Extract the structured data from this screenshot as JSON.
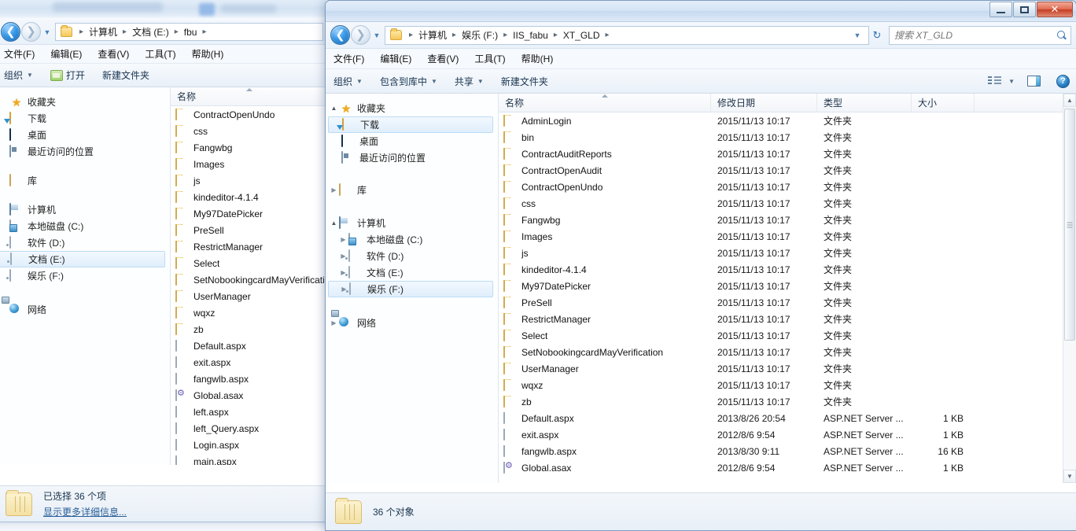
{
  "back_window": {
    "address": {
      "breadcrumbs": [
        "计算机",
        "文档 (E:)",
        "fbu"
      ],
      "separator": "▸"
    },
    "menus": [
      "文件(F)",
      "编辑(E)",
      "查看(V)",
      "工具(T)",
      "帮助(H)"
    ],
    "commands": {
      "organize": "组织",
      "open": "打开",
      "new_folder": "新建文件夹"
    },
    "nav_pane": [
      {
        "label": "收藏夹",
        "icon": "star-icon",
        "level": 0,
        "twisty": "",
        "selected": false
      },
      {
        "label": "下载",
        "icon": "downloads-icon",
        "level": 1,
        "twisty": "",
        "selected": false
      },
      {
        "label": "桌面",
        "icon": "desktop-icon",
        "level": 1,
        "twisty": "",
        "selected": false
      },
      {
        "label": "最近访问的位置",
        "icon": "recent-places-icon",
        "level": 1,
        "twisty": "",
        "selected": false
      },
      {
        "label": "库",
        "icon": "library-icon",
        "level": 0,
        "twisty": "",
        "selected": false
      },
      {
        "label": "计算机",
        "icon": "computer-icon",
        "level": 0,
        "twisty": "",
        "selected": false
      },
      {
        "label": "本地磁盘 (C:)",
        "icon": "system-drive-icon",
        "level": 1,
        "twisty": "",
        "selected": false
      },
      {
        "label": "软件 (D:)",
        "icon": "drive-icon",
        "level": 1,
        "twisty": "",
        "selected": false
      },
      {
        "label": "文档 (E:)",
        "icon": "drive-icon",
        "level": 1,
        "twisty": "",
        "selected": true
      },
      {
        "label": "娱乐 (F:)",
        "icon": "drive-icon",
        "level": 1,
        "twisty": "",
        "selected": false
      },
      {
        "label": "网络",
        "icon": "network-icon",
        "level": 0,
        "twisty": "",
        "selected": false
      }
    ],
    "column_header": "名称",
    "files": [
      {
        "name": "ContractOpenUndo",
        "icon": "folder-icon"
      },
      {
        "name": "css",
        "icon": "folder-icon"
      },
      {
        "name": "Fangwbg",
        "icon": "folder-icon"
      },
      {
        "name": "Images",
        "icon": "folder-icon"
      },
      {
        "name": "js",
        "icon": "folder-icon"
      },
      {
        "name": "kindeditor-4.1.4",
        "icon": "folder-icon"
      },
      {
        "name": "My97DatePicker",
        "icon": "folder-icon"
      },
      {
        "name": "PreSell",
        "icon": "folder-icon"
      },
      {
        "name": "RestrictManager",
        "icon": "folder-icon"
      },
      {
        "name": "Select",
        "icon": "folder-icon"
      },
      {
        "name": "SetNobookingcardMayVerification",
        "icon": "folder-icon"
      },
      {
        "name": "UserManager",
        "icon": "folder-icon"
      },
      {
        "name": "wqxz",
        "icon": "folder-icon"
      },
      {
        "name": "zb",
        "icon": "folder-icon"
      },
      {
        "name": "Default.aspx",
        "icon": "aspx-file-icon"
      },
      {
        "name": "exit.aspx",
        "icon": "aspx-file-icon"
      },
      {
        "name": "fangwlb.aspx",
        "icon": "aspx-file-icon"
      },
      {
        "name": "Global.asax",
        "icon": "asax-file-icon"
      },
      {
        "name": "left.aspx",
        "icon": "aspx-file-icon"
      },
      {
        "name": "left_Query.aspx",
        "icon": "aspx-file-icon"
      },
      {
        "name": "Login.aspx",
        "icon": "aspx-file-icon"
      },
      {
        "name": "main.aspx",
        "icon": "aspx-file-icon"
      }
    ],
    "status": {
      "line1": "已选择 36 个项",
      "link": "显示更多详细信息..."
    }
  },
  "front_window": {
    "title": "",
    "window_buttons": {
      "minimize": "—",
      "maximize": "❐",
      "close": "✕"
    },
    "address": {
      "breadcrumbs": [
        "计算机",
        "娱乐 (F:)",
        "IIS_fabu",
        "XT_GLD"
      ],
      "separator": "▸"
    },
    "search": {
      "placeholder": "搜索 XT_GLD",
      "value": ""
    },
    "menus": [
      "文件(F)",
      "编辑(E)",
      "查看(V)",
      "工具(T)",
      "帮助(H)"
    ],
    "commands": {
      "organize": "组织",
      "include_in_library": "包含到库中",
      "share": "共享",
      "new_folder": "新建文件夹"
    },
    "nav_pane": [
      {
        "label": "收藏夹",
        "icon": "star-icon",
        "level": 0,
        "twisty": "▲",
        "selected": false
      },
      {
        "label": "下载",
        "icon": "downloads-icon",
        "level": 1,
        "twisty": "",
        "selected": true
      },
      {
        "label": "桌面",
        "icon": "desktop-icon",
        "level": 1,
        "twisty": "",
        "selected": false
      },
      {
        "label": "最近访问的位置",
        "icon": "recent-places-icon",
        "level": 1,
        "twisty": "",
        "selected": false
      },
      {
        "label": "库",
        "icon": "library-icon",
        "level": 0,
        "twisty": "▶",
        "selected": false
      },
      {
        "label": "计算机",
        "icon": "computer-icon",
        "level": 0,
        "twisty": "▲",
        "selected": false
      },
      {
        "label": "本地磁盘 (C:)",
        "icon": "system-drive-icon",
        "level": 1,
        "twisty": "▶",
        "selected": false
      },
      {
        "label": "软件 (D:)",
        "icon": "drive-icon",
        "level": 1,
        "twisty": "▶",
        "selected": false
      },
      {
        "label": "文档 (E:)",
        "icon": "drive-icon",
        "level": 1,
        "twisty": "▶",
        "selected": false
      },
      {
        "label": "娱乐 (F:)",
        "icon": "drive-icon",
        "level": 1,
        "twisty": "▶",
        "selected": true
      },
      {
        "label": "网络",
        "icon": "network-icon",
        "level": 0,
        "twisty": "▶",
        "selected": false
      }
    ],
    "columns": [
      "名称",
      "修改日期",
      "类型",
      "大小"
    ],
    "files": [
      {
        "name": "AdminLogin",
        "date": "2015/11/13 10:17",
        "type": "文件夹",
        "size": "",
        "icon": "folder-icon"
      },
      {
        "name": "bin",
        "date": "2015/11/13 10:17",
        "type": "文件夹",
        "size": "",
        "icon": "folder-icon"
      },
      {
        "name": "ContractAuditReports",
        "date": "2015/11/13 10:17",
        "type": "文件夹",
        "size": "",
        "icon": "folder-icon"
      },
      {
        "name": "ContractOpenAudit",
        "date": "2015/11/13 10:17",
        "type": "文件夹",
        "size": "",
        "icon": "folder-icon"
      },
      {
        "name": "ContractOpenUndo",
        "date": "2015/11/13 10:17",
        "type": "文件夹",
        "size": "",
        "icon": "folder-icon"
      },
      {
        "name": "css",
        "date": "2015/11/13 10:17",
        "type": "文件夹",
        "size": "",
        "icon": "folder-icon"
      },
      {
        "name": "Fangwbg",
        "date": "2015/11/13 10:17",
        "type": "文件夹",
        "size": "",
        "icon": "folder-icon"
      },
      {
        "name": "Images",
        "date": "2015/11/13 10:17",
        "type": "文件夹",
        "size": "",
        "icon": "folder-icon"
      },
      {
        "name": "js",
        "date": "2015/11/13 10:17",
        "type": "文件夹",
        "size": "",
        "icon": "folder-icon"
      },
      {
        "name": "kindeditor-4.1.4",
        "date": "2015/11/13 10:17",
        "type": "文件夹",
        "size": "",
        "icon": "folder-icon"
      },
      {
        "name": "My97DatePicker",
        "date": "2015/11/13 10:17",
        "type": "文件夹",
        "size": "",
        "icon": "folder-icon"
      },
      {
        "name": "PreSell",
        "date": "2015/11/13 10:17",
        "type": "文件夹",
        "size": "",
        "icon": "folder-icon"
      },
      {
        "name": "RestrictManager",
        "date": "2015/11/13 10:17",
        "type": "文件夹",
        "size": "",
        "icon": "folder-icon"
      },
      {
        "name": "Select",
        "date": "2015/11/13 10:17",
        "type": "文件夹",
        "size": "",
        "icon": "folder-icon"
      },
      {
        "name": "SetNobookingcardMayVerification",
        "date": "2015/11/13 10:17",
        "type": "文件夹",
        "size": "",
        "icon": "folder-icon"
      },
      {
        "name": "UserManager",
        "date": "2015/11/13 10:17",
        "type": "文件夹",
        "size": "",
        "icon": "folder-icon"
      },
      {
        "name": "wqxz",
        "date": "2015/11/13 10:17",
        "type": "文件夹",
        "size": "",
        "icon": "folder-icon"
      },
      {
        "name": "zb",
        "date": "2015/11/13 10:17",
        "type": "文件夹",
        "size": "",
        "icon": "folder-icon"
      },
      {
        "name": "Default.aspx",
        "date": "2013/8/26 20:54",
        "type": "ASP.NET Server ...",
        "size": "1 KB",
        "icon": "aspx-file-icon"
      },
      {
        "name": "exit.aspx",
        "date": "2012/8/6 9:54",
        "type": "ASP.NET Server ...",
        "size": "1 KB",
        "icon": "aspx-file-icon"
      },
      {
        "name": "fangwlb.aspx",
        "date": "2013/8/30 9:11",
        "type": "ASP.NET Server ...",
        "size": "16 KB",
        "icon": "aspx-file-icon"
      },
      {
        "name": "Global.asax",
        "date": "2012/8/6 9:54",
        "type": "ASP.NET Server ...",
        "size": "1 KB",
        "icon": "asax-file-icon"
      }
    ],
    "status": {
      "line1": "36 个对象",
      "link": ""
    }
  }
}
